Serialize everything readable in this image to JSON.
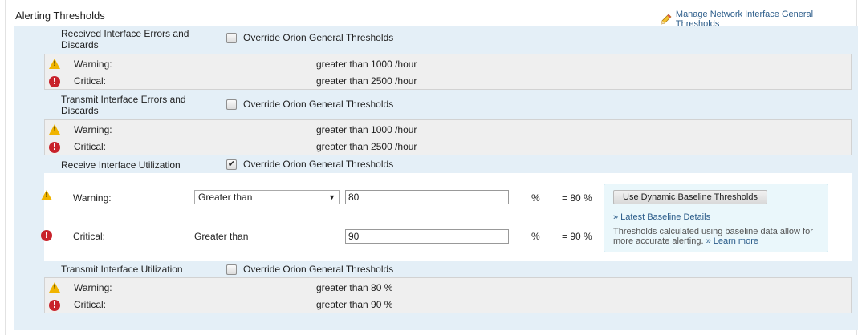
{
  "title": "Alerting Thresholds",
  "manage_link": "Manage Network Interface General Thresholds",
  "override_label": "Override Orion General Thresholds",
  "sections": [
    {
      "name": "Received Interface Errors and Discards",
      "override_checked": false,
      "warning_label": "Warning:",
      "warning_value": "greater than 1000 /hour",
      "critical_label": "Critical:",
      "critical_value": "greater than 2500 /hour"
    },
    {
      "name": "Transmit Interface Errors and Discards",
      "override_checked": false,
      "warning_label": "Warning:",
      "warning_value": "greater than 1000 /hour",
      "critical_label": "Critical:",
      "critical_value": "greater than 2500 /hour"
    },
    {
      "name": "Receive Interface Utilization",
      "override_checked": true,
      "warning_label": "Warning:",
      "warning_operator": "Greater than",
      "warning_input": "80",
      "warning_unit": "%",
      "warning_result": "= 80 %",
      "critical_label": "Critical:",
      "critical_operator": "Greater than",
      "critical_input": "90",
      "critical_unit": "%",
      "critical_result": "= 90 %"
    },
    {
      "name": "Transmit Interface Utilization",
      "override_checked": false,
      "warning_label": "Warning:",
      "warning_value": "greater than 80 %",
      "critical_label": "Critical:",
      "critical_value": "greater than 90 %"
    }
  ],
  "baseline": {
    "button_label": "Use Dynamic Baseline Thresholds",
    "details_link": "» Latest Baseline Details",
    "note": "Thresholds calculated using baseline data allow for more accurate alerting.",
    "learn_more": "» Learn more"
  },
  "colors": {
    "panel_bg": "#e4eff7",
    "warning": "#f0b400",
    "critical": "#c8222b",
    "link": "#2b5c8a"
  },
  "icons": {
    "warning": "warning-icon",
    "critical": "critical-icon",
    "edit": "pencil-icon"
  }
}
